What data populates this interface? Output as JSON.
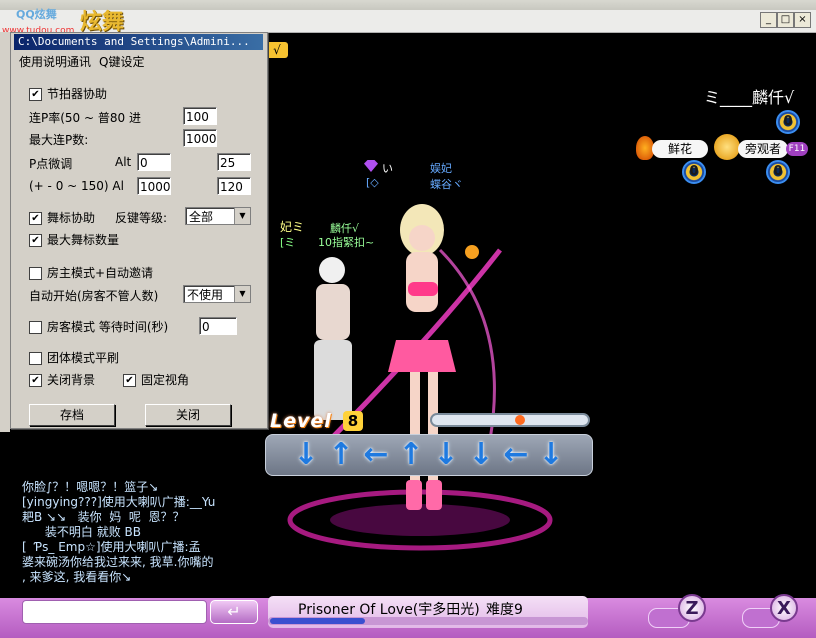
{
  "window": {
    "path_title": "C:\\Documents and Settings\\Admini...",
    "logo_small": "QQ炫舞",
    "logo_large": "炫舞",
    "logo_url": "www.tudou.com"
  },
  "helper": {
    "tabs": [
      "使用说明",
      "通讯",
      "Q键设定"
    ],
    "metronome_label": "节拍器协助",
    "metronome_checked": true,
    "combo_rate_label": "连P率(50 ~ 普80 进",
    "combo_rate_value": "100",
    "max_combo_label": "最大连P数:",
    "max_combo_value": "1000",
    "p_adjust_label": "P点微调",
    "alt_label": "Alt",
    "alt_value": "0",
    "p_adjust_right1": "25",
    "range_label": "(+ - 0 ~ 150) Al",
    "alt2_value": "1000",
    "p_adjust_right2": "120",
    "dance_label": "舞标协助",
    "dance_checked": true,
    "reverse_level_label": "反键等级:",
    "reverse_level_value": "全部",
    "max_dance_label": "最大舞标数量",
    "max_dance_checked": true,
    "host_mode_label": "房主模式+自动邀请",
    "host_mode_checked": false,
    "auto_start_label": "自动开始(房客不管人数)",
    "auto_start_value": "不使用",
    "guest_mode_label": "房客模式  等待时间(秒)",
    "guest_mode_checked": false,
    "guest_wait_value": "0",
    "team_mode_label": "团体模式平刷",
    "team_mode_checked": false,
    "close_bg_label": "关闭背景",
    "close_bg_checked": true,
    "fixed_view_label": "固定视角",
    "fixed_view_checked": true,
    "save_label": "存档",
    "close_label": "关闭"
  },
  "hud": {
    "player_name": "ミ____麟仟√",
    "top_badge": "√",
    "flower_label": "鲜花",
    "observer_label": "旁观者",
    "observer_key": "F11",
    "ring_value": "0",
    "char1_name": "娱妃",
    "char1_sub": "蝶谷ヾ",
    "char1_prefix": "い",
    "char2_name": "麟仟√",
    "char2_sub": "10指緊扣~",
    "char3_name": "妃ミ",
    "char3_prefix": "[ミ"
  },
  "stage": {
    "level_label": "Level",
    "level_value": "8",
    "arrows": [
      "↓",
      "↑",
      "←",
      "↑",
      "↓",
      "↓",
      "←",
      "↓"
    ],
    "progress_fraction": 0.57
  },
  "chat": {
    "lines": [
      "你脸∫？！嗯嗯？！篮子↘",
      "[yingying???]使用大喇叭广播:__Yu",
      "耙B ↘↘   装你  妈  呢  恩？？",
      "      装不明白 就败 BB",
      "[  Ƥs_ Emp☆]使用大喇叭广播:孟",
      "婆来碗汤你给我过来来, 我草.你嘴的",
      ", 来爹这, 我看看你↘"
    ],
    "send_icon": "↵"
  },
  "song": {
    "title": "Prisoner Of Love(宇多田光)",
    "difficulty": "难度9",
    "progress_fraction": 0.3,
    "btn_z": "Z",
    "btn_x": "X"
  }
}
